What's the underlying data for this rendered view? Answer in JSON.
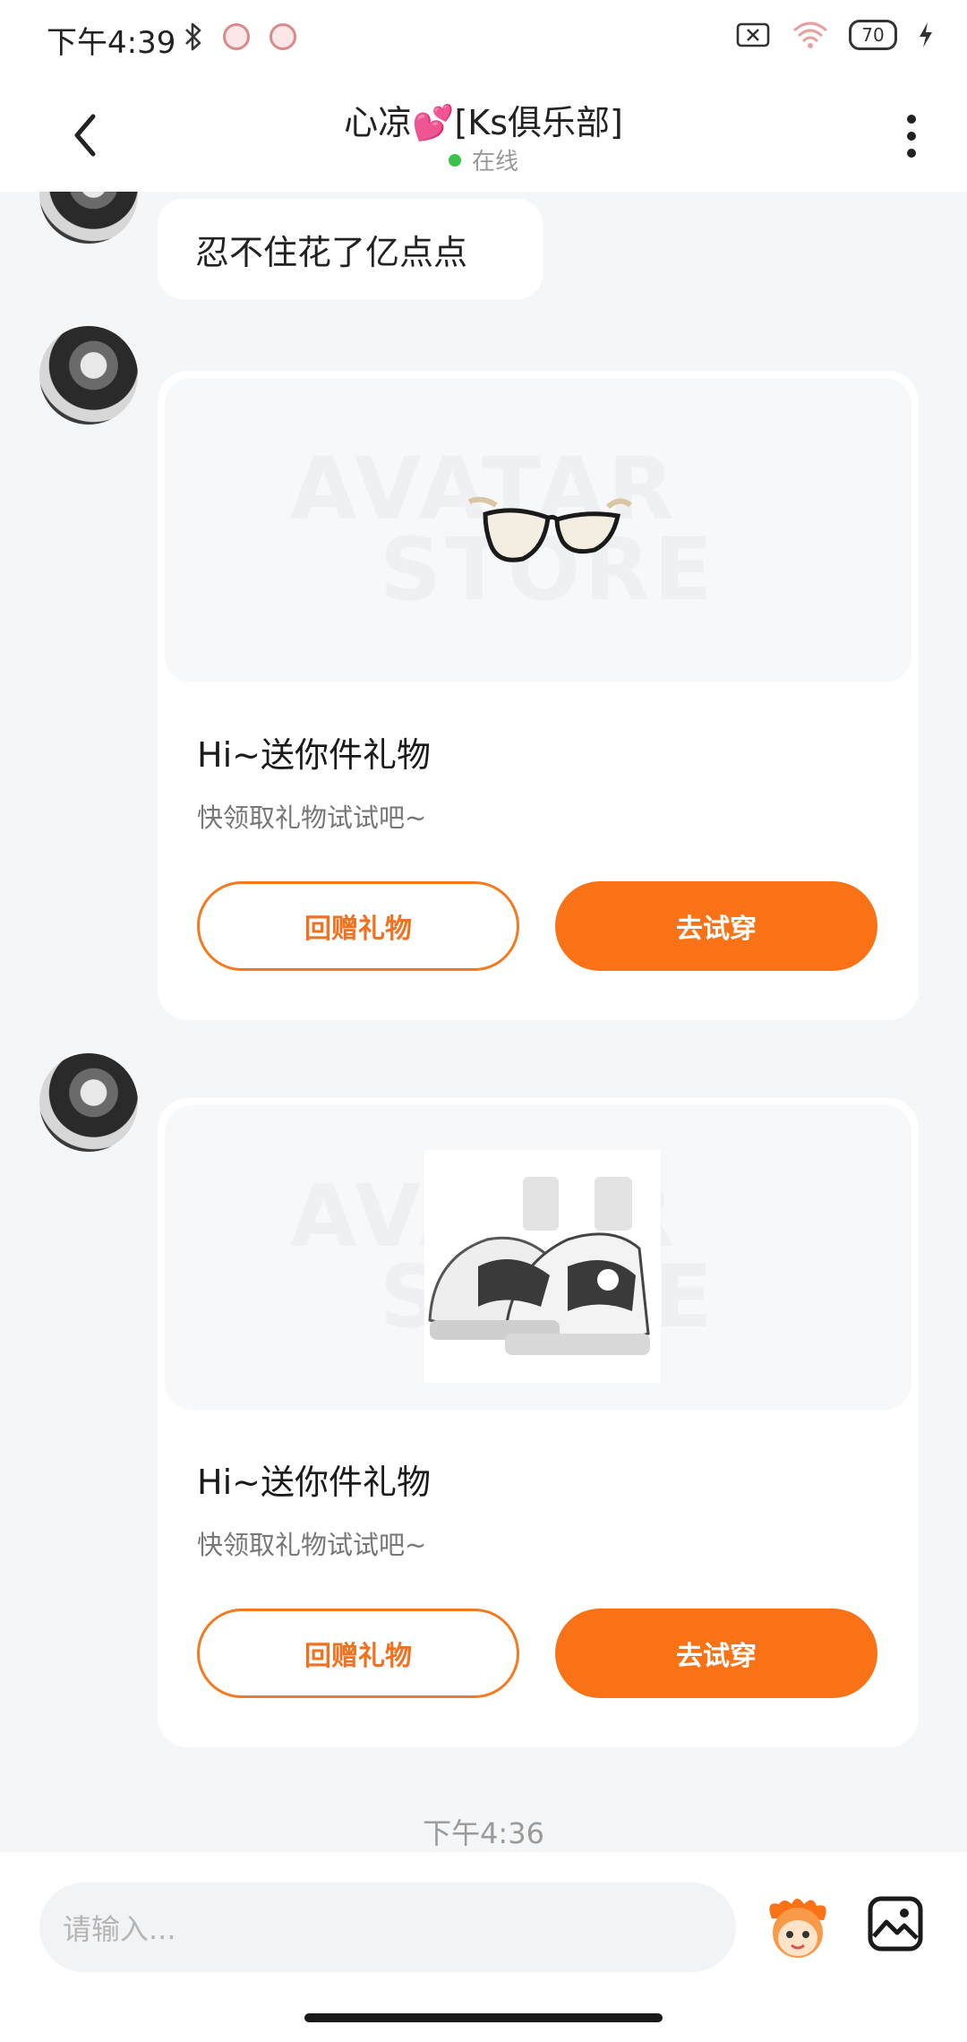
{
  "status_bar": {
    "time": "下午4:39",
    "battery": "70"
  },
  "header": {
    "title": "心凉💕[Ks俱乐部]",
    "presence": "在线"
  },
  "messages": [
    {
      "type": "text",
      "text": "忍不住花了亿点点"
    },
    {
      "type": "gift",
      "item": "glasses",
      "watermark_line1": "AVATAR",
      "watermark_line2": "STORE",
      "title": "Hi~送你件礼物",
      "subtitle": "快领取礼物试试吧~",
      "return_label": "回赠礼物",
      "try_label": "去试穿"
    },
    {
      "type": "gift",
      "item": "sneakers",
      "watermark_line1": "AVATAR",
      "watermark_line2": "STORE",
      "title": "Hi~送你件礼物",
      "subtitle": "快领取礼物试试吧~",
      "return_label": "回赠礼物",
      "try_label": "去试穿"
    }
  ],
  "timestamp": "下午4:36",
  "input": {
    "placeholder": "请输入..."
  },
  "colors": {
    "accent": "#f97316",
    "online": "#3ac24a",
    "background": "#f5f6f8"
  },
  "icons": {
    "back": "chevron-left-icon",
    "more": "more-vertical-icon",
    "emoji": "mascot-emoji-icon",
    "image": "image-icon"
  }
}
